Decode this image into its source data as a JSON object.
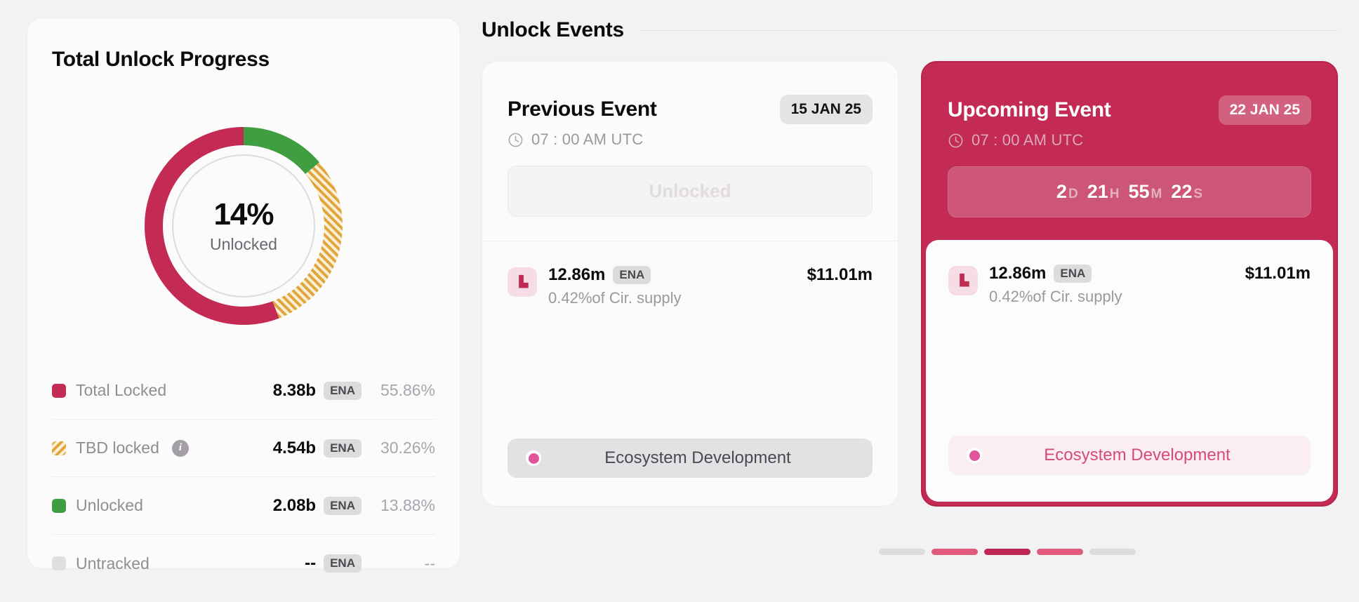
{
  "left_panel": {
    "title": "Total Unlock Progress",
    "donut": {
      "center_value": "14%",
      "center_label": "Unlocked"
    },
    "legend": [
      {
        "label": "Total Locked",
        "amount": "8.38b",
        "chip": "ENA",
        "percent": "55.86%",
        "swatch": "sw-locked",
        "has_info": false
      },
      {
        "label": "TBD locked",
        "amount": "4.54b",
        "chip": "ENA",
        "percent": "30.26%",
        "swatch": "sw-tbd",
        "has_info": true,
        "info_icon": "info-icon"
      },
      {
        "label": "Unlocked",
        "amount": "2.08b",
        "chip": "ENA",
        "percent": "13.88%",
        "swatch": "sw-unlocked",
        "has_info": false
      },
      {
        "label": "Untracked",
        "amount": "--",
        "chip": "ENA",
        "percent": "--",
        "swatch": "sw-untracked",
        "has_info": false
      }
    ]
  },
  "right_section": {
    "title": "Unlock Events",
    "previous_event": {
      "title": "Previous Event",
      "date_badge": "15 JAN 25",
      "clock_icon": "clock-icon",
      "time": "07 : 00 AM UTC",
      "status_button": "Unlocked",
      "token": {
        "icon": "token-icon",
        "amount": "12.86m",
        "chip": "ENA",
        "supply": "0.42%of Cir. supply",
        "usd_value": "$11.01m"
      },
      "tag": {
        "dot_icon": "category-dot-icon",
        "label": "Ecosystem Development"
      }
    },
    "upcoming_event": {
      "title": "Upcoming Event",
      "date_badge": "22 JAN 25",
      "clock_icon": "clock-icon",
      "time": "07 : 00 AM UTC",
      "countdown": {
        "days": "2",
        "days_unit": "D",
        "hours": "21",
        "hours_unit": "H",
        "minutes": "55",
        "minutes_unit": "M",
        "seconds": "22",
        "seconds_unit": "S"
      },
      "token": {
        "icon": "token-icon",
        "amount": "12.86m",
        "chip": "ENA",
        "supply": "0.42%of Cir. supply",
        "usd_value": "$11.01m"
      },
      "tag": {
        "dot_icon": "category-dot-icon",
        "label": "Ecosystem Development"
      }
    },
    "pagination": [
      {
        "color": "#dcdcdc"
      },
      {
        "color": "#e15a7d"
      },
      {
        "color": "#be2550"
      },
      {
        "color": "#e15a7d"
      },
      {
        "color": "#dcdcdc"
      }
    ]
  },
  "chart_data": {
    "type": "pie",
    "title": "Total Unlock Progress",
    "categories": [
      "Unlocked",
      "TBD locked",
      "Total Locked",
      "Untracked"
    ],
    "values": [
      13.88,
      30.26,
      55.86,
      0
    ],
    "value_labels": [
      "2.08b ENA",
      "4.54b ENA",
      "8.38b ENA",
      "-- ENA"
    ],
    "colors": [
      "#3f9e3f",
      "#e0a63c",
      "#c32a54",
      "#dedede"
    ],
    "unit": "%",
    "center_text": "14%",
    "center_subtext": "Unlocked",
    "donut": true,
    "start_angle_deg": 0,
    "legend_position": "bottom"
  }
}
